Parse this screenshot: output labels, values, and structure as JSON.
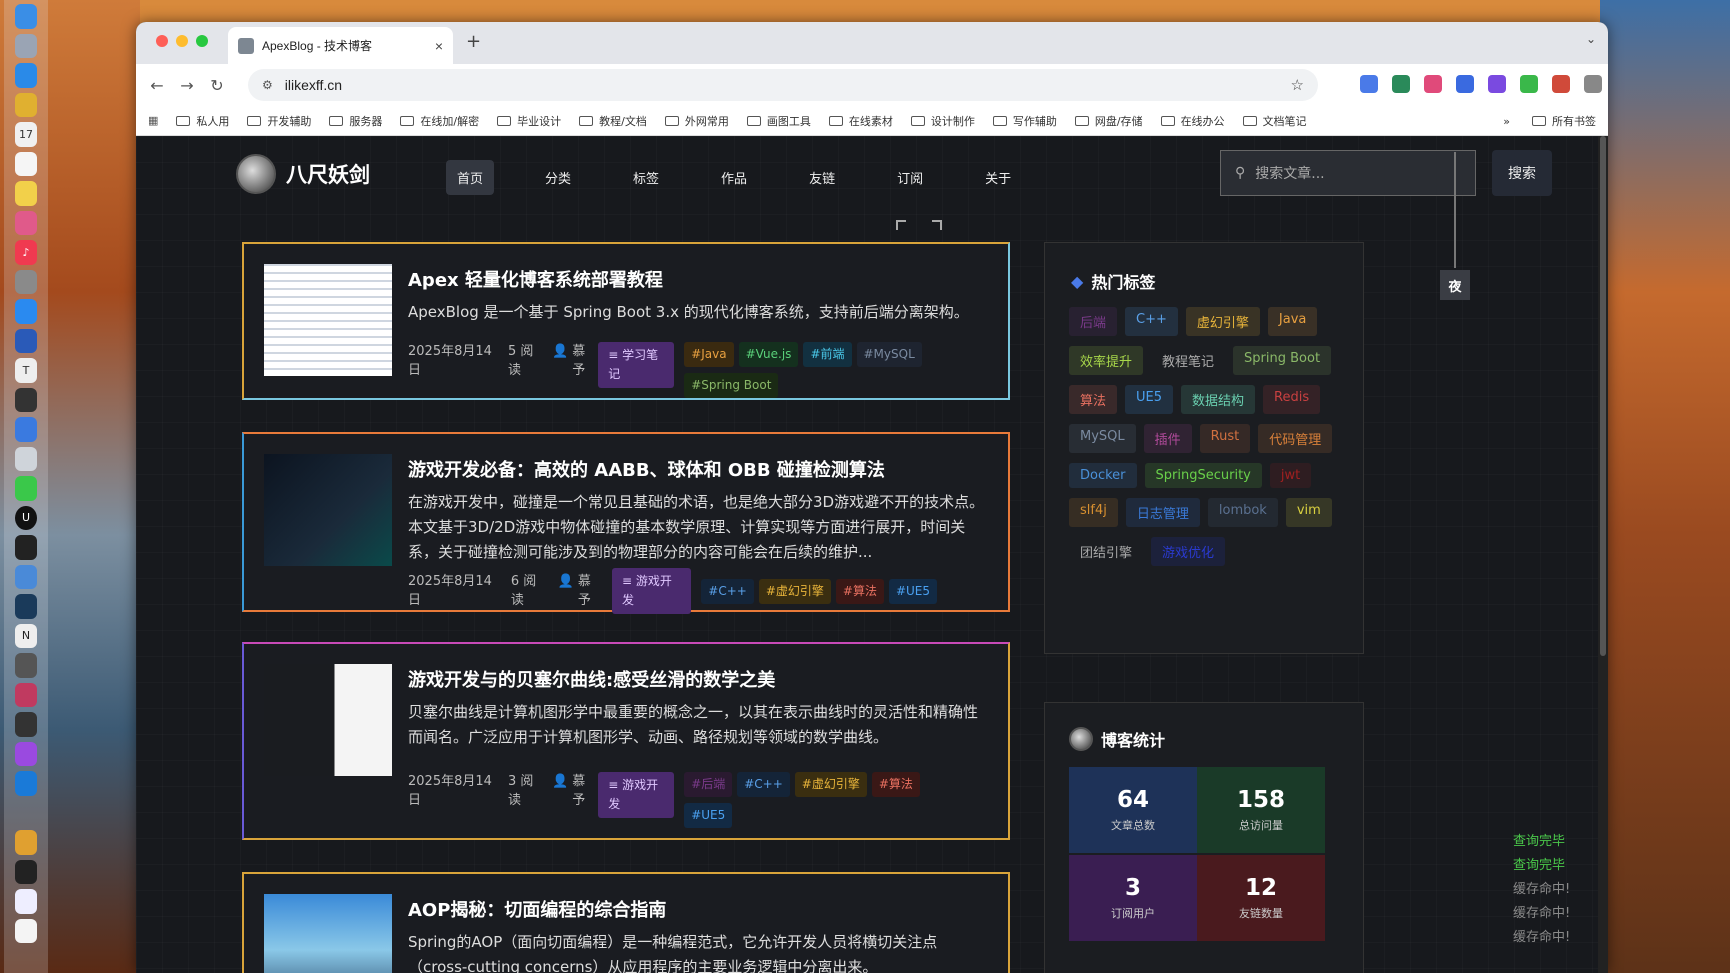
{
  "browser": {
    "tab_title": "ApexBlog - 技术博客",
    "url": "ilikexff.cn",
    "new_tab": "+",
    "close": "×",
    "bookmarks": [
      "私人用",
      "开发辅助",
      "服务器",
      "在线加/解密",
      "毕业设计",
      "教程/文档",
      "外网常用",
      "画图工具",
      "在线素材",
      "设计制作",
      "写作辅助",
      "网盘/存储",
      "在线办公",
      "文档笔记"
    ],
    "more": "»",
    "all_bookmarks": "所有书签"
  },
  "site": {
    "logo": "八尺妖剑",
    "nav": [
      "首页",
      "分类",
      "标签",
      "作品",
      "友链",
      "订阅",
      "关于"
    ],
    "search_placeholder": "搜索文章...",
    "search_button": "搜索",
    "night": "夜"
  },
  "posts": [
    {
      "title": "Apex 轻量化博客系统部署教程",
      "summary": "ApexBlog 是一个基于 Spring Boot 3.x 的现代化博客系统，支持前后端分离架构。",
      "date": "2025年8月14日",
      "reads": "5 阅读",
      "author": "慕予",
      "category": "学习笔记",
      "tags": [
        "#Java",
        "#Vue.js",
        "#前端",
        "#MySQL",
        "#Spring Boot"
      ]
    },
    {
      "title": "游戏开发必备：高效的 AABB、球体和 OBB 碰撞检测算法",
      "summary": "在游戏开发中，碰撞是一个常见且基础的术语，也是绝大部分3D游戏避不开的技术点。本文基于3D/2D游戏中物体碰撞的基本数学原理、计算实现等方面进行展开，时间关系，关于碰撞检测可能涉及到的物理部分的内容可能会在后续的维护...",
      "date": "2025年8月14日",
      "reads": "6 阅读",
      "author": "慕予",
      "category": "游戏开发",
      "tags": [
        "#C++",
        "#虚幻引擎",
        "#算法",
        "#UE5"
      ]
    },
    {
      "title": "游戏开发与的贝塞尔曲线:感受丝滑的数学之美",
      "summary": "贝塞尔曲线是计算机图形学中最重要的概念之一，以其在表示曲线时的灵活性和精确性而闻名。广泛应用于计算机图形学、动画、路径规划等领域的数学曲线。",
      "date": "2025年8月14日",
      "reads": "3 阅读",
      "author": "慕予",
      "category": "游戏开发",
      "tags": [
        "#后端",
        "#C++",
        "#虚幻引擎",
        "#算法",
        "#UE5"
      ]
    },
    {
      "title": "AOP揭秘：切面编程的综合指南",
      "summary": "Spring的AOP（面向切面编程）是一种编程范式，它允许开发人员将横切关注点（cross-cutting concerns）从应用程序的主要业务逻辑中分离出来。"
    }
  ],
  "hot_tags": {
    "title": "热门标签",
    "items": [
      {
        "label": "后端",
        "color": "#7a3a8a"
      },
      {
        "label": "C++",
        "color": "#5aa0e8"
      },
      {
        "label": "虚幻引擎",
        "color": "#e8b43a"
      },
      {
        "label": "Java",
        "color": "#e8a040"
      },
      {
        "label": "效率提升",
        "color": "#a8d84a"
      },
      {
        "label": "教程笔记",
        "color": "#aaa"
      },
      {
        "label": "Spring Boot",
        "color": "#8ab868"
      },
      {
        "label": "算法",
        "color": "#e87060"
      },
      {
        "label": "UE5",
        "color": "#4aa0f0"
      },
      {
        "label": "数据结构",
        "color": "#6ad0b0"
      },
      {
        "label": "Redis",
        "color": "#c84040"
      },
      {
        "label": "MySQL",
        "color": "#7a8aa0"
      },
      {
        "label": "插件",
        "color": "#b04a9a"
      },
      {
        "label": "Rust",
        "color": "#d07040"
      },
      {
        "label": "代码管理",
        "color": "#d8803a"
      },
      {
        "label": "Docker",
        "color": "#4a90d8"
      },
      {
        "label": "SpringSecurity",
        "color": "#6ad04a"
      },
      {
        "label": "jwt",
        "color": "#a02020"
      },
      {
        "label": "slf4j",
        "color": "#d89030"
      },
      {
        "label": "日志管理",
        "color": "#3a7ad8"
      },
      {
        "label": "lombok",
        "color": "#5a7090"
      },
      {
        "label": "vim",
        "color": "#d8d040"
      },
      {
        "label": "团结引擎",
        "color": "#aaa"
      },
      {
        "label": "游戏优化",
        "color": "#2a3ad0"
      }
    ]
  },
  "stats": {
    "title": "博客统计",
    "items": [
      {
        "value": "64",
        "label": "文章总数",
        "color": "#1e3258"
      },
      {
        "value": "158",
        "label": "总访问量",
        "color": "#1a3a28"
      },
      {
        "value": "3",
        "label": "订阅用户",
        "color": "#3a1e52"
      },
      {
        "value": "12",
        "label": "友链数量",
        "color": "#4a1a1e"
      }
    ]
  },
  "logs": [
    {
      "text": "查询完毕",
      "color": "#4ac84a"
    },
    {
      "text": "查询完毕",
      "color": "#4ac84a"
    },
    {
      "text": "缓存命中!",
      "color": "#8a8a8a"
    },
    {
      "text": "缓存命中!",
      "color": "#8a8a8a"
    },
    {
      "text": "缓存命中!",
      "color": "#8a8a8a"
    }
  ]
}
